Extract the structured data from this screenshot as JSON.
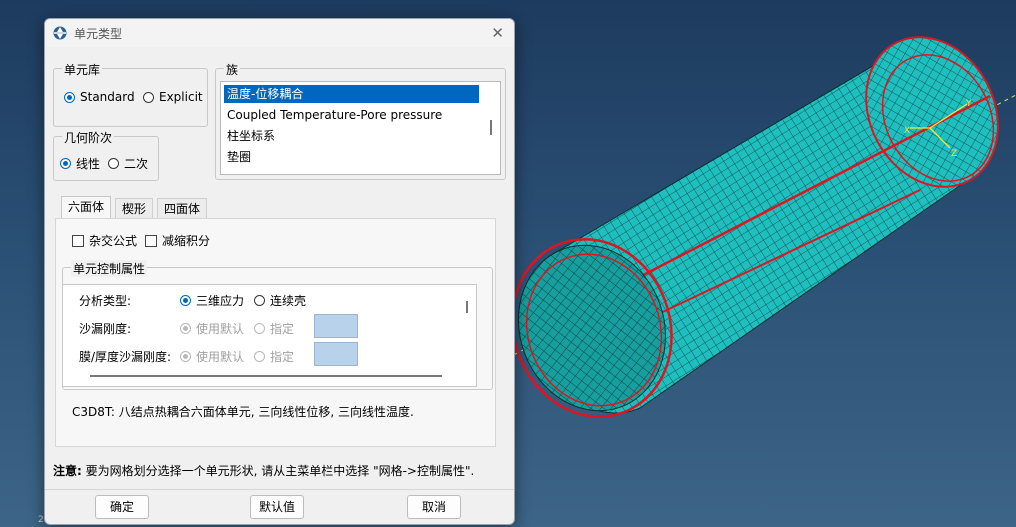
{
  "dialog": {
    "title": "单元类型",
    "element_library": {
      "label": "单元库",
      "options": [
        {
          "label": "Standard",
          "selected": true
        },
        {
          "label": "Explicit",
          "selected": false
        }
      ]
    },
    "geometric_order": {
      "label": "几何阶次",
      "options": [
        {
          "label": "线性",
          "selected": true
        },
        {
          "label": "二次",
          "selected": false
        }
      ]
    },
    "family": {
      "label": "族",
      "items": [
        "温度-位移耦合",
        "Coupled Temperature-Pore pressure",
        "柱坐标系",
        "垫圈"
      ],
      "selected_index": 0
    },
    "tabs": [
      {
        "label": "六面体",
        "active": true
      },
      {
        "label": "楔形",
        "active": false
      },
      {
        "label": "四面体",
        "active": false
      }
    ],
    "checks": {
      "hybrid": {
        "label": "杂交公式",
        "checked": false
      },
      "reduced": {
        "label": "减缩积分",
        "checked": false
      }
    },
    "controls": {
      "label": "单元控制属性",
      "analysis_type": {
        "label": "分析类型:",
        "options": [
          {
            "label": "三维应力",
            "selected": true
          },
          {
            "label": "连续壳",
            "selected": false
          }
        ]
      },
      "hourglass": {
        "label": "沙漏刚度:",
        "options": [
          {
            "label": "使用默认",
            "selected": true
          },
          {
            "label": "指定",
            "selected": false
          }
        ]
      },
      "membrane_hourglass": {
        "label": "膜/厚度沙漏刚度:",
        "options": [
          {
            "label": "使用默认",
            "selected": true
          },
          {
            "label": "指定",
            "selected": false
          }
        ]
      }
    },
    "description": "C3D8T:  八结点热耦合六面体单元, 三向线性位移, 三向线性温度.",
    "note_prefix": "注意:",
    "note_text": "要为网格划分选择一个单元形状, 请从主菜单栏中选择 \"网格->控制属性\".",
    "buttons": {
      "ok": "确定",
      "defaults": "默认值",
      "cancel": "取消"
    }
  },
  "viewport": {
    "mesh_color": "#1fbfbf",
    "edge_color": "#e0141e",
    "triad_labels": {
      "csys_x": "X",
      "csys_y": "Y",
      "csys_z": "Z"
    },
    "bottom_left_text": "2"
  },
  "colors": {
    "accent": "#0067c0",
    "background": "#2a4f74"
  }
}
